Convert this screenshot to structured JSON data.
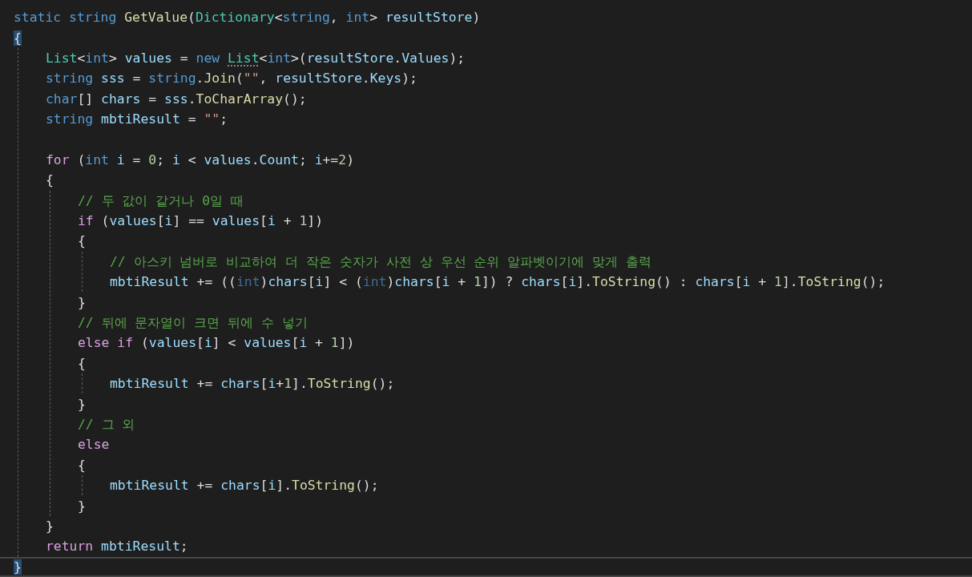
{
  "editor": {
    "lines": [
      {
        "kind": "code",
        "tokens": [
          {
            "text": "static string",
            "kind": "keyword"
          },
          {
            "text": " GetValue",
            "kind": "method"
          },
          {
            "text": "(",
            "kind": "plain"
          },
          {
            "text": "Dictionary",
            "kind": "type"
          },
          {
            "text": "<",
            "kind": "plain"
          },
          {
            "text": "string",
            "kind": "keyword"
          },
          {
            "text": ", ",
            "kind": "plain"
          },
          {
            "text": "int",
            "kind": "keyword"
          },
          {
            "text": "> ",
            "kind": "plain"
          },
          {
            "text": "resultStore",
            "kind": "variable"
          },
          {
            "text": ")",
            "kind": "plain"
          }
        ]
      },
      {
        "kind": "code",
        "tokens": [
          {
            "text": "{",
            "kind": "plain",
            "matched": true
          }
        ],
        "children": [
          {
            "kind": "code",
            "tokens": [
              {
                "text": "List",
                "kind": "type"
              },
              {
                "text": "<",
                "kind": "plain"
              },
              {
                "text": "int",
                "kind": "keyword"
              },
              {
                "text": "> ",
                "kind": "plain"
              },
              {
                "text": "values",
                "kind": "variable"
              },
              {
                "text": " = ",
                "kind": "plain"
              },
              {
                "text": "new ",
                "kind": "keyword"
              },
              {
                "text": "List",
                "kind": "type",
                "hint": true
              },
              {
                "text": "<",
                "kind": "plain"
              },
              {
                "text": "int",
                "kind": "keyword"
              },
              {
                "text": ">(",
                "kind": "plain"
              },
              {
                "text": "resultStore",
                "kind": "variable"
              },
              {
                "text": ".",
                "kind": "plain"
              },
              {
                "text": "Values",
                "kind": "variable"
              },
              {
                "text": ");",
                "kind": "plain"
              }
            ]
          },
          {
            "kind": "code",
            "tokens": [
              {
                "text": "string",
                "kind": "keyword"
              },
              {
                "text": " sss",
                "kind": "variable"
              },
              {
                "text": " = ",
                "kind": "plain"
              },
              {
                "text": "string",
                "kind": "keyword"
              },
              {
                "text": ".",
                "kind": "plain"
              },
              {
                "text": "Join",
                "kind": "method"
              },
              {
                "text": "(",
                "kind": "plain"
              },
              {
                "text": "\"\"",
                "kind": "string"
              },
              {
                "text": ", ",
                "kind": "plain"
              },
              {
                "text": "resultStore",
                "kind": "variable"
              },
              {
                "text": ".",
                "kind": "plain"
              },
              {
                "text": "Keys",
                "kind": "variable"
              },
              {
                "text": ");",
                "kind": "plain"
              }
            ]
          },
          {
            "kind": "code",
            "tokens": [
              {
                "text": "char",
                "kind": "keyword"
              },
              {
                "text": "[] ",
                "kind": "plain"
              },
              {
                "text": "chars",
                "kind": "variable"
              },
              {
                "text": " = ",
                "kind": "plain"
              },
              {
                "text": "sss",
                "kind": "variable"
              },
              {
                "text": ".",
                "kind": "plain"
              },
              {
                "text": "ToCharArray",
                "kind": "method"
              },
              {
                "text": "();",
                "kind": "plain"
              }
            ]
          },
          {
            "kind": "code",
            "tokens": [
              {
                "text": "string",
                "kind": "keyword"
              },
              {
                "text": " mbtiResult",
                "kind": "variable"
              },
              {
                "text": " = ",
                "kind": "plain"
              },
              {
                "text": "\"\"",
                "kind": "string"
              },
              {
                "text": ";",
                "kind": "plain"
              }
            ]
          },
          {
            "kind": "blank"
          },
          {
            "kind": "code",
            "tokens": [
              {
                "text": "for",
                "kind": "control"
              },
              {
                "text": " (",
                "kind": "plain"
              },
              {
                "text": "int",
                "kind": "keyword"
              },
              {
                "text": " i",
                "kind": "variable"
              },
              {
                "text": " = ",
                "kind": "plain"
              },
              {
                "text": "0",
                "kind": "number"
              },
              {
                "text": "; ",
                "kind": "plain"
              },
              {
                "text": "i",
                "kind": "variable"
              },
              {
                "text": " < ",
                "kind": "plain"
              },
              {
                "text": "values",
                "kind": "variable"
              },
              {
                "text": ".",
                "kind": "plain"
              },
              {
                "text": "Count",
                "kind": "variable"
              },
              {
                "text": "; ",
                "kind": "plain"
              },
              {
                "text": "i",
                "kind": "variable"
              },
              {
                "text": "+=",
                "kind": "plain"
              },
              {
                "text": "2",
                "kind": "number"
              },
              {
                "text": ")",
                "kind": "plain"
              }
            ]
          },
          {
            "kind": "code",
            "tokens": [
              {
                "text": "{",
                "kind": "plain"
              }
            ],
            "children": [
              {
                "kind": "code",
                "tokens": [
                  {
                    "text": "// 두 값이 같거나 0일 때",
                    "kind": "comment"
                  }
                ]
              },
              {
                "kind": "code",
                "tokens": [
                  {
                    "text": "if",
                    "kind": "control"
                  },
                  {
                    "text": " (",
                    "kind": "plain"
                  },
                  {
                    "text": "values",
                    "kind": "variable"
                  },
                  {
                    "text": "[",
                    "kind": "plain"
                  },
                  {
                    "text": "i",
                    "kind": "variable"
                  },
                  {
                    "text": "] == ",
                    "kind": "plain"
                  },
                  {
                    "text": "values",
                    "kind": "variable"
                  },
                  {
                    "text": "[",
                    "kind": "plain"
                  },
                  {
                    "text": "i",
                    "kind": "variable"
                  },
                  {
                    "text": " + ",
                    "kind": "plain"
                  },
                  {
                    "text": "1",
                    "kind": "number"
                  },
                  {
                    "text": "])",
                    "kind": "plain"
                  }
                ]
              },
              {
                "kind": "code",
                "tokens": [
                  {
                    "text": "{",
                    "kind": "plain"
                  }
                ],
                "children": [
                  {
                    "kind": "code",
                    "tokens": [
                      {
                        "text": "// 아스키 넘버로 비교하여 더 작은 숫자가 사전 상 우선 순위 알파벳이기에 맞게 출력",
                        "kind": "comment"
                      }
                    ]
                  },
                  {
                    "kind": "code",
                    "tokens": [
                      {
                        "text": "mbtiResult",
                        "kind": "variable"
                      },
                      {
                        "text": " += ((",
                        "kind": "plain"
                      },
                      {
                        "text": "int",
                        "kind": "faded"
                      },
                      {
                        "text": ")",
                        "kind": "plain"
                      },
                      {
                        "text": "chars",
                        "kind": "variable"
                      },
                      {
                        "text": "[",
                        "kind": "plain"
                      },
                      {
                        "text": "i",
                        "kind": "variable"
                      },
                      {
                        "text": "] < (",
                        "kind": "plain"
                      },
                      {
                        "text": "int",
                        "kind": "faded"
                      },
                      {
                        "text": ")",
                        "kind": "plain"
                      },
                      {
                        "text": "chars",
                        "kind": "variable"
                      },
                      {
                        "text": "[",
                        "kind": "plain"
                      },
                      {
                        "text": "i",
                        "kind": "variable"
                      },
                      {
                        "text": " + ",
                        "kind": "plain"
                      },
                      {
                        "text": "1",
                        "kind": "number"
                      },
                      {
                        "text": "]) ? ",
                        "kind": "plain"
                      },
                      {
                        "text": "chars",
                        "kind": "variable"
                      },
                      {
                        "text": "[",
                        "kind": "plain"
                      },
                      {
                        "text": "i",
                        "kind": "variable"
                      },
                      {
                        "text": "].",
                        "kind": "plain"
                      },
                      {
                        "text": "ToString",
                        "kind": "method"
                      },
                      {
                        "text": "() : ",
                        "kind": "plain"
                      },
                      {
                        "text": "chars",
                        "kind": "variable"
                      },
                      {
                        "text": "[",
                        "kind": "plain"
                      },
                      {
                        "text": "i",
                        "kind": "variable"
                      },
                      {
                        "text": " + ",
                        "kind": "plain"
                      },
                      {
                        "text": "1",
                        "kind": "number"
                      },
                      {
                        "text": "].",
                        "kind": "plain"
                      },
                      {
                        "text": "ToString",
                        "kind": "method"
                      },
                      {
                        "text": "();",
                        "kind": "plain"
                      }
                    ]
                  }
                ]
              },
              {
                "kind": "code",
                "tokens": [
                  {
                    "text": "}",
                    "kind": "plain"
                  }
                ]
              },
              {
                "kind": "code",
                "tokens": [
                  {
                    "text": "// 뒤에 문자열이 크면 뒤에 수 넣기",
                    "kind": "comment"
                  }
                ]
              },
              {
                "kind": "code",
                "tokens": [
                  {
                    "text": "else if",
                    "kind": "control"
                  },
                  {
                    "text": " (",
                    "kind": "plain"
                  },
                  {
                    "text": "values",
                    "kind": "variable"
                  },
                  {
                    "text": "[",
                    "kind": "plain"
                  },
                  {
                    "text": "i",
                    "kind": "variable"
                  },
                  {
                    "text": "] < ",
                    "kind": "plain"
                  },
                  {
                    "text": "values",
                    "kind": "variable"
                  },
                  {
                    "text": "[",
                    "kind": "plain"
                  },
                  {
                    "text": "i",
                    "kind": "variable"
                  },
                  {
                    "text": " + ",
                    "kind": "plain"
                  },
                  {
                    "text": "1",
                    "kind": "number"
                  },
                  {
                    "text": "])",
                    "kind": "plain"
                  }
                ]
              },
              {
                "kind": "code",
                "tokens": [
                  {
                    "text": "{",
                    "kind": "plain"
                  }
                ],
                "children": [
                  {
                    "kind": "code",
                    "tokens": [
                      {
                        "text": "mbtiResult",
                        "kind": "variable"
                      },
                      {
                        "text": " += ",
                        "kind": "plain"
                      },
                      {
                        "text": "chars",
                        "kind": "variable"
                      },
                      {
                        "text": "[",
                        "kind": "plain"
                      },
                      {
                        "text": "i",
                        "kind": "variable"
                      },
                      {
                        "text": "+",
                        "kind": "plain"
                      },
                      {
                        "text": "1",
                        "kind": "number"
                      },
                      {
                        "text": "].",
                        "kind": "plain"
                      },
                      {
                        "text": "ToString",
                        "kind": "method"
                      },
                      {
                        "text": "();",
                        "kind": "plain"
                      }
                    ]
                  }
                ]
              },
              {
                "kind": "code",
                "tokens": [
                  {
                    "text": "}",
                    "kind": "plain"
                  }
                ]
              },
              {
                "kind": "code",
                "tokens": [
                  {
                    "text": "// 그 외",
                    "kind": "comment"
                  }
                ]
              },
              {
                "kind": "code",
                "tokens": [
                  {
                    "text": "else",
                    "kind": "control"
                  }
                ]
              },
              {
                "kind": "code",
                "tokens": [
                  {
                    "text": "{",
                    "kind": "plain"
                  }
                ],
                "children": [
                  {
                    "kind": "code",
                    "tokens": [
                      {
                        "text": "mbtiResult",
                        "kind": "variable"
                      },
                      {
                        "text": " += ",
                        "kind": "plain"
                      },
                      {
                        "text": "chars",
                        "kind": "variable"
                      },
                      {
                        "text": "[",
                        "kind": "plain"
                      },
                      {
                        "text": "i",
                        "kind": "variable"
                      },
                      {
                        "text": "].",
                        "kind": "plain"
                      },
                      {
                        "text": "ToString",
                        "kind": "method"
                      },
                      {
                        "text": "();",
                        "kind": "plain"
                      }
                    ]
                  }
                ]
              },
              {
                "kind": "code",
                "tokens": [
                  {
                    "text": "}",
                    "kind": "plain"
                  }
                ]
              }
            ]
          },
          {
            "kind": "code",
            "tokens": [
              {
                "text": "}",
                "kind": "plain"
              }
            ]
          },
          {
            "kind": "code",
            "tokens": [
              {
                "text": "return",
                "kind": "control"
              },
              {
                "text": " mbtiResult",
                "kind": "variable"
              },
              {
                "text": ";",
                "kind": "plain"
              }
            ]
          }
        ]
      },
      {
        "kind": "code",
        "tokens": [
          {
            "text": "}",
            "kind": "plain",
            "matched": true
          }
        ],
        "current": true
      }
    ]
  }
}
